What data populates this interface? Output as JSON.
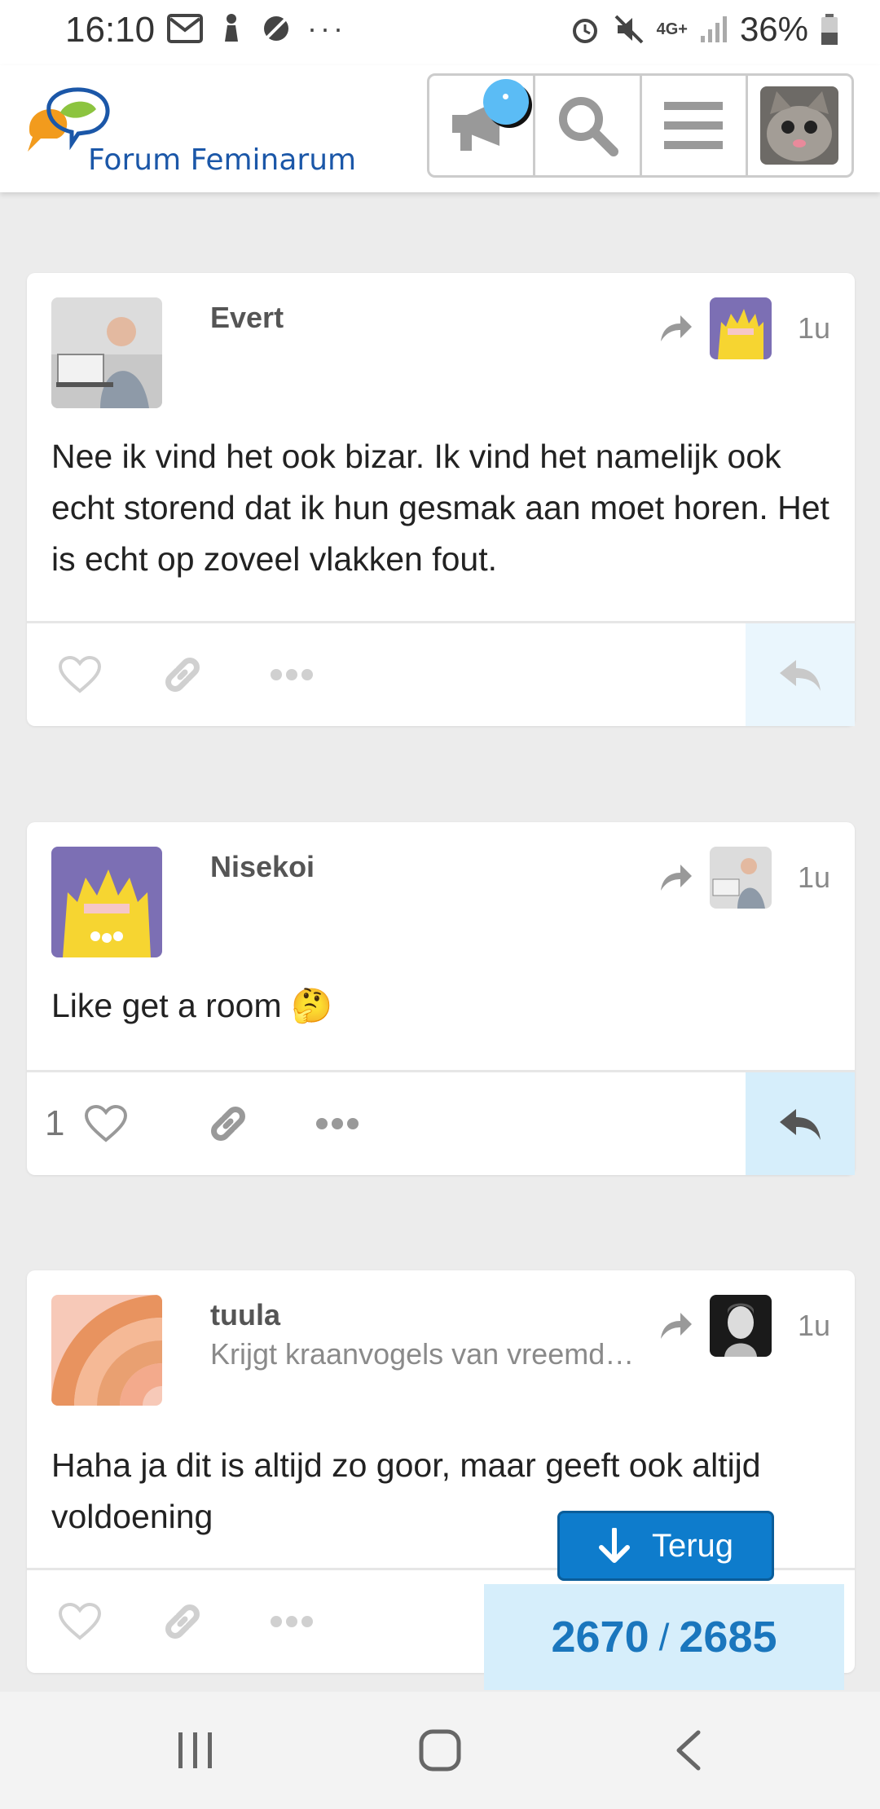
{
  "status_bar": {
    "time": "16:10",
    "network": "4G+",
    "battery": "36%"
  },
  "header": {
    "logo_text": "Forum Feminarum",
    "icons": [
      "megaphone-icon",
      "search-icon",
      "hamburger-menu-icon",
      "user-avatar-cat"
    ]
  },
  "posts": [
    {
      "username": "Evert",
      "user_title": "",
      "time": "1u",
      "body": "Nee ik vind het ook bizar. Ik vind het namelijk ook echt storend dat ik hun gesmak aan moet horen. Het is echt op zoveel vlakken fout.",
      "like_count": ""
    },
    {
      "username": "Nisekoi",
      "user_title": "",
      "time": "1u",
      "body": "Like get a room 🤔",
      "like_count": "1"
    },
    {
      "username": "tuula",
      "user_title": "Krijgt kraanvogels van vreemd…",
      "time": "1u",
      "body": "Haha ja dit is altijd zo goor, maar geeft ook altijd voldoening",
      "like_count": ""
    }
  ],
  "floating": {
    "terug_label": "Terug",
    "progress_current": "2670",
    "progress_separator": "/",
    "progress_total": "2685"
  },
  "colors": {
    "accent": "#0e7ccc",
    "progress_bg": "#d6eefb",
    "reply_active_bg": "#d6eefb",
    "reply_bg": "#eaf6fd"
  }
}
